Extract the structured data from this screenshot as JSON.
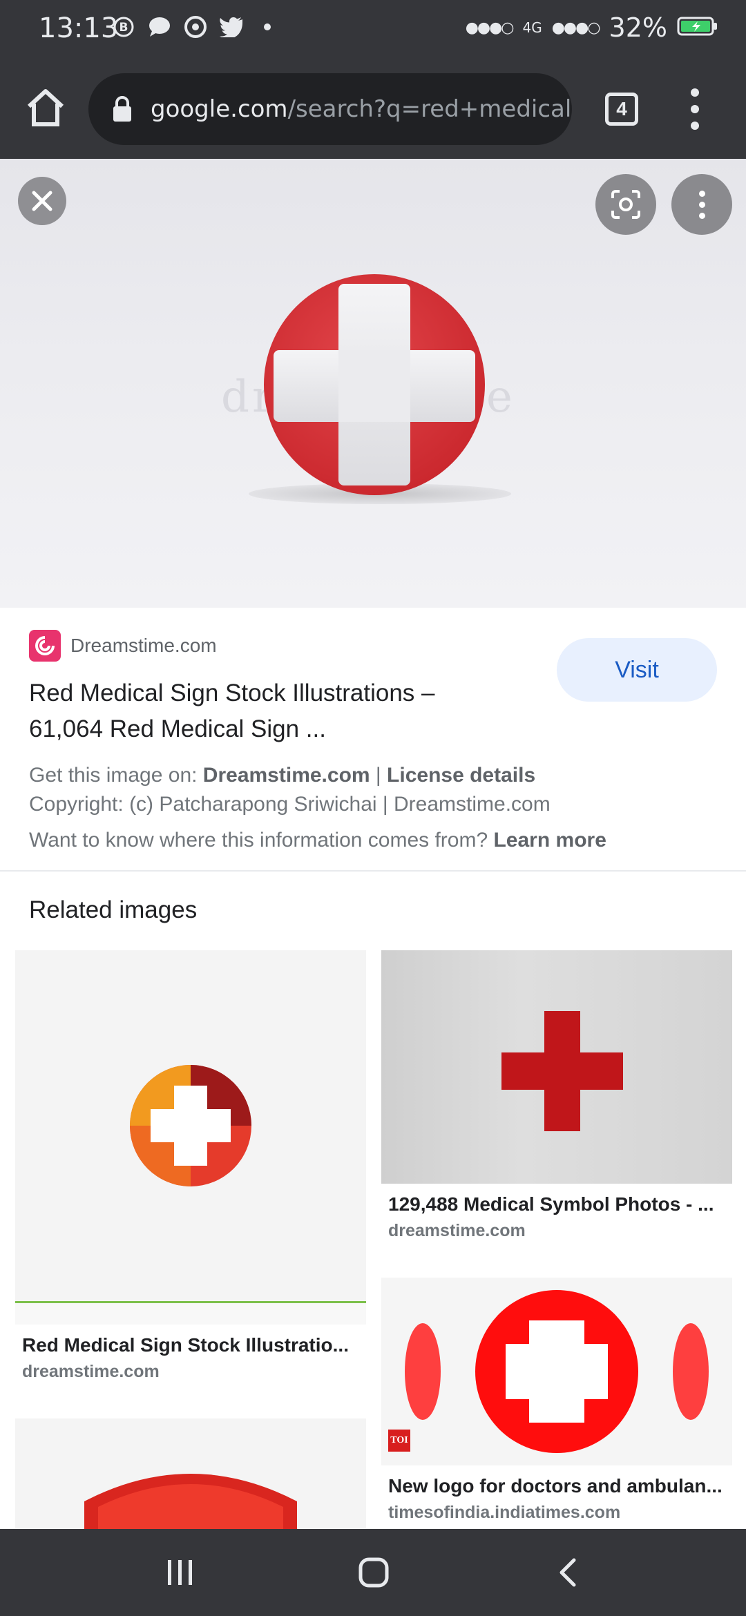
{
  "status_bar": {
    "time": "13:13",
    "network": "4G",
    "battery": "32%"
  },
  "toolbar": {
    "url_domain": "google.com",
    "url_path": "/search?q=red+medical+symb",
    "tab_count": "4"
  },
  "result": {
    "site_name": "Dreamstime.com",
    "visit_label": "Visit",
    "title_line1": "Red Medical Sign Stock Illustrations –",
    "title_line2": "61,064 Red Medical Sign ...",
    "get_image_prefix": "Get this image on: ",
    "get_image_site": "Dreamstime.com",
    "separator": " | ",
    "license_details": "License details",
    "copyright": "Copyright: (c) Patcharapong Sriwichai | Dreamstime.com",
    "info_question": "Want to know where this information comes from? ",
    "learn_more": "Learn more",
    "watermark": "dreamstime"
  },
  "related": {
    "heading": "Related images",
    "items": [
      {
        "title": "Red Medical Sign Stock Illustratio...",
        "source": "dreamstime.com"
      },
      {
        "title": "129,488 Medical Symbol Photos - ...",
        "source": "dreamstime.com"
      },
      {
        "title": "New logo for doctors and ambulan...",
        "source": "timesofindia.indiatimes.com"
      }
    ],
    "toi_badge": "TOI"
  },
  "colors": {
    "accent_blue": "#1a5bc4",
    "medical_red": "#d62c32",
    "chrome_dark": "#35363a"
  },
  "icons": [
    "home-icon",
    "lock-icon",
    "tabs-icon",
    "overflow-menu-icon",
    "close-icon",
    "lens-icon",
    "recent-apps-icon",
    "home-nav-icon",
    "back-icon"
  ]
}
